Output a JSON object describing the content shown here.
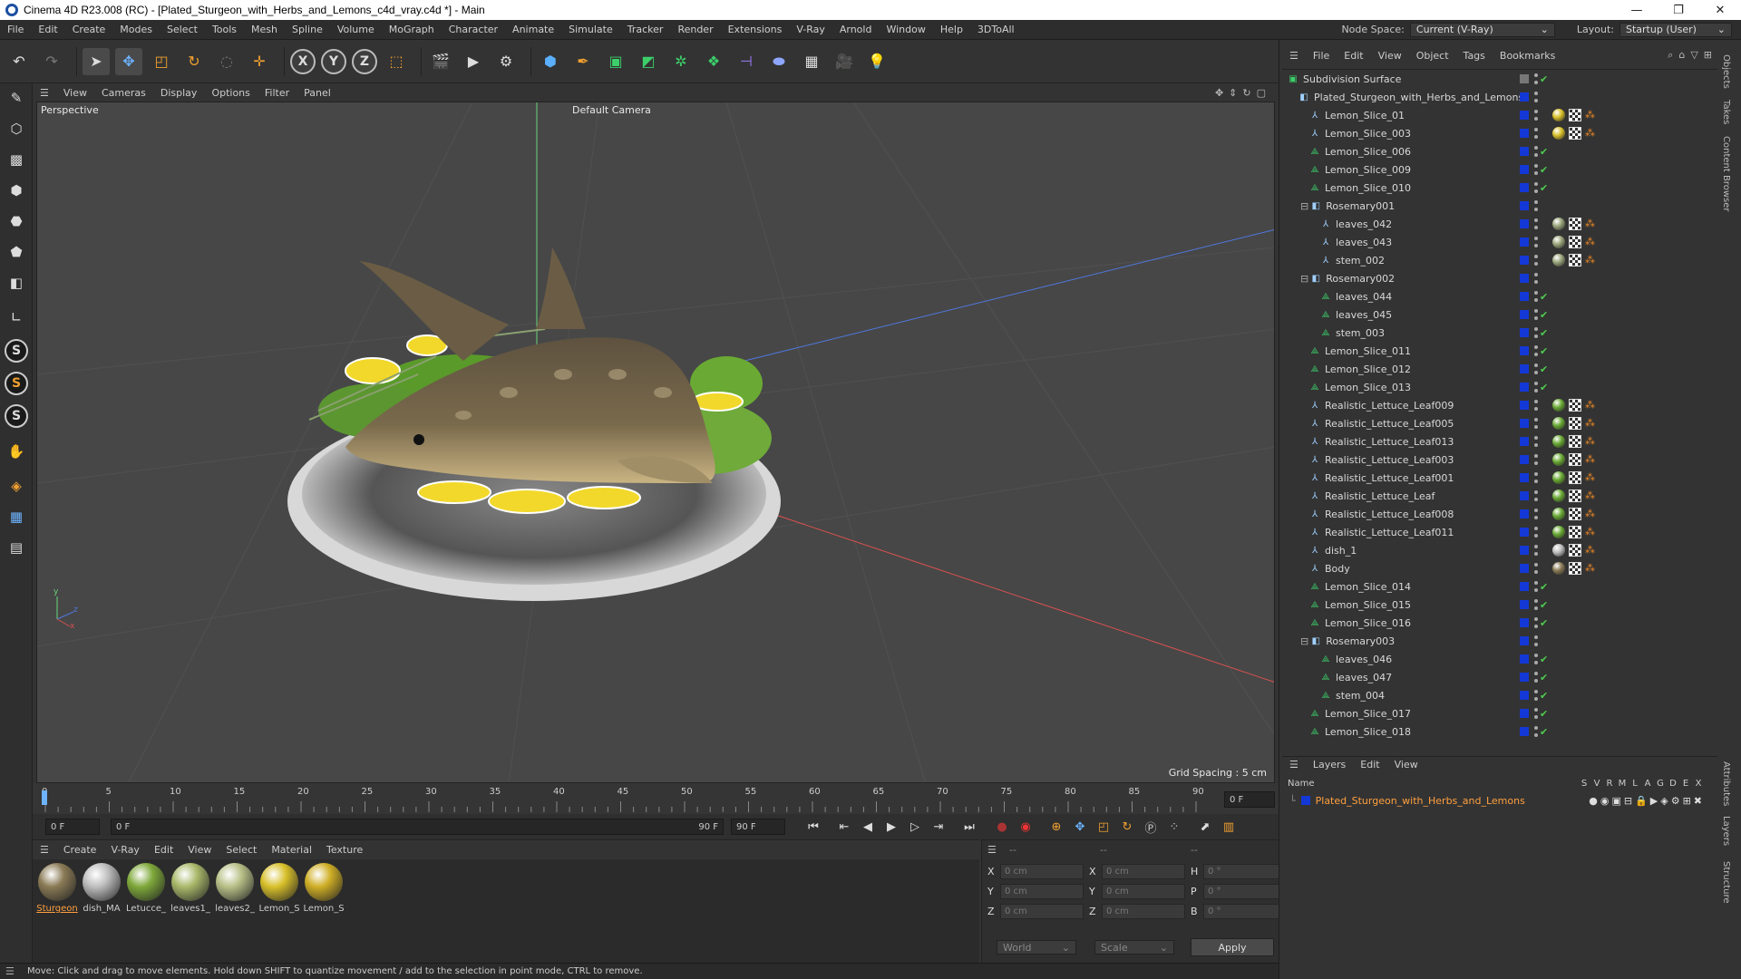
{
  "window": {
    "title": "Cinema 4D R23.008 (RC) - [Plated_Sturgeon_with_Herbs_and_Lemons_c4d_vray.c4d *] - Main",
    "buttons": [
      "—",
      "❐",
      "✕"
    ]
  },
  "menubar": {
    "items": [
      "File",
      "Edit",
      "Create",
      "Modes",
      "Select",
      "Tools",
      "Mesh",
      "Spline",
      "Volume",
      "MoGraph",
      "Character",
      "Animate",
      "Simulate",
      "Tracker",
      "Render",
      "Extensions",
      "V-Ray",
      "Arnold",
      "Window",
      "Help",
      "3DToAll"
    ],
    "node_space_label": "Node Space:",
    "node_space_value": "Current (V-Ray)",
    "layout_label": "Layout:",
    "layout_value": "Startup (User)"
  },
  "toolbar": {
    "axis_x": "X",
    "axis_y": "Y",
    "axis_z": "Z"
  },
  "viewport": {
    "menu": [
      "View",
      "Cameras",
      "Display",
      "Options",
      "Filter",
      "Panel"
    ],
    "name": "Perspective",
    "camera": "Default Camera",
    "grid_spacing": "Grid Spacing : 5 cm"
  },
  "timeline": {
    "ticks": [
      "0",
      "5",
      "10",
      "15",
      "20",
      "25",
      "30",
      "35",
      "40",
      "45",
      "50",
      "55",
      "60",
      "65",
      "70",
      "75",
      "80",
      "85",
      "90"
    ],
    "current_frame_field": "0 F",
    "start_field": "0 F",
    "range_start": "0 F",
    "range_end": "90 F",
    "end_field": "90 F"
  },
  "material_manager": {
    "menu": [
      "Create",
      "V-Ray",
      "Edit",
      "View",
      "Select",
      "Material",
      "Texture"
    ],
    "materials": [
      {
        "name": "Sturgeon",
        "color": "#8a7a55"
      },
      {
        "name": "dish_MA",
        "color": "#bdbdbd"
      },
      {
        "name": "Letucce_",
        "color": "#7ea83a"
      },
      {
        "name": "leaves1_",
        "color": "#a9b86a"
      },
      {
        "name": "leaves2_",
        "color": "#b8c087"
      },
      {
        "name": "Lemon_S",
        "color": "#d8c02a"
      },
      {
        "name": "Lemon_S",
        "color": "#cfae25"
      }
    ]
  },
  "coordinates": {
    "header": [
      "--",
      "--",
      "--"
    ],
    "rows": [
      {
        "a": "X",
        "v1": "0 cm",
        "b": "X",
        "v2": "0 cm",
        "c": "H",
        "v3": "0 °"
      },
      {
        "a": "Y",
        "v1": "0 cm",
        "b": "Y",
        "v2": "0 cm",
        "c": "P",
        "v3": "0 °"
      },
      {
        "a": "Z",
        "v1": "0 cm",
        "b": "Z",
        "v2": "0 cm",
        "c": "B",
        "v3": "0 °"
      }
    ],
    "space": "World",
    "mode": "Scale",
    "apply": "Apply"
  },
  "statusbar": {
    "text": "Move: Click and drag to move elements. Hold down SHIFT to quantize movement / add to the selection in point mode, CTRL to remove."
  },
  "object_manager": {
    "menu": [
      "File",
      "Edit",
      "View",
      "Object",
      "Tags",
      "Bookmarks"
    ],
    "objects": [
      {
        "name": "Subdivision Surface",
        "indent": 0,
        "icon": "subdivision",
        "tags": "none",
        "check": true
      },
      {
        "name": "Plated_Sturgeon_with_Herbs_and_Lemons",
        "indent": 1,
        "icon": "null",
        "tags": "none",
        "check": false
      },
      {
        "name": "Lemon_Slice_01",
        "indent": 2,
        "icon": "bone",
        "tags": "lemon",
        "check": false
      },
      {
        "name": "Lemon_Slice_003",
        "indent": 2,
        "icon": "bone",
        "tags": "lemon",
        "check": false
      },
      {
        "name": "Lemon_Slice_006",
        "indent": 2,
        "icon": "poly",
        "tags": "none",
        "check": true
      },
      {
        "name": "Lemon_Slice_009",
        "indent": 2,
        "icon": "poly",
        "tags": "none",
        "check": true
      },
      {
        "name": "Lemon_Slice_010",
        "indent": 2,
        "icon": "poly",
        "tags": "none",
        "check": true
      },
      {
        "name": "Rosemary001",
        "indent": 2,
        "icon": "null",
        "tags": "none",
        "check": false
      },
      {
        "name": "leaves_042",
        "indent": 3,
        "icon": "bone",
        "tags": "herb",
        "check": false
      },
      {
        "name": "leaves_043",
        "indent": 3,
        "icon": "bone",
        "tags": "herb",
        "check": false
      },
      {
        "name": "stem_002",
        "indent": 3,
        "icon": "bone",
        "tags": "herb",
        "check": false
      },
      {
        "name": "Rosemary002",
        "indent": 2,
        "icon": "null",
        "tags": "none",
        "check": false
      },
      {
        "name": "leaves_044",
        "indent": 3,
        "icon": "poly",
        "tags": "none",
        "check": true
      },
      {
        "name": "leaves_045",
        "indent": 3,
        "icon": "poly",
        "tags": "none",
        "check": true
      },
      {
        "name": "stem_003",
        "indent": 3,
        "icon": "poly",
        "tags": "none",
        "check": true
      },
      {
        "name": "Lemon_Slice_011",
        "indent": 2,
        "icon": "poly",
        "tags": "none",
        "check": true
      },
      {
        "name": "Lemon_Slice_012",
        "indent": 2,
        "icon": "poly",
        "tags": "none",
        "check": true
      },
      {
        "name": "Lemon_Slice_013",
        "indent": 2,
        "icon": "poly",
        "tags": "none",
        "check": true
      },
      {
        "name": "Realistic_Lettuce_Leaf009",
        "indent": 2,
        "icon": "bone",
        "tags": "lettuce",
        "check": false
      },
      {
        "name": "Realistic_Lettuce_Leaf005",
        "indent": 2,
        "icon": "bone",
        "tags": "lettuce",
        "check": false
      },
      {
        "name": "Realistic_Lettuce_Leaf013",
        "indent": 2,
        "icon": "bone",
        "tags": "lettuce",
        "check": false
      },
      {
        "name": "Realistic_Lettuce_Leaf003",
        "indent": 2,
        "icon": "bone",
        "tags": "lettuce",
        "check": false
      },
      {
        "name": "Realistic_Lettuce_Leaf001",
        "indent": 2,
        "icon": "bone",
        "tags": "lettuce",
        "check": false
      },
      {
        "name": "Realistic_Lettuce_Leaf",
        "indent": 2,
        "icon": "bone",
        "tags": "lettuce",
        "check": false
      },
      {
        "name": "Realistic_Lettuce_Leaf008",
        "indent": 2,
        "icon": "bone",
        "tags": "lettuce",
        "check": false
      },
      {
        "name": "Realistic_Lettuce_Leaf011",
        "indent": 2,
        "icon": "bone",
        "tags": "lettuce",
        "check": false
      },
      {
        "name": "dish_1",
        "indent": 2,
        "icon": "bone",
        "tags": "dish",
        "check": false
      },
      {
        "name": "Body",
        "indent": 2,
        "icon": "bone",
        "tags": "body",
        "check": false
      },
      {
        "name": "Lemon_Slice_014",
        "indent": 2,
        "icon": "poly",
        "tags": "none",
        "check": true
      },
      {
        "name": "Lemon_Slice_015",
        "indent": 2,
        "icon": "poly",
        "tags": "none",
        "check": true
      },
      {
        "name": "Lemon_Slice_016",
        "indent": 2,
        "icon": "poly",
        "tags": "none",
        "check": true
      },
      {
        "name": "Rosemary003",
        "indent": 2,
        "icon": "null",
        "tags": "none",
        "check": false
      },
      {
        "name": "leaves_046",
        "indent": 3,
        "icon": "poly",
        "tags": "none",
        "check": true
      },
      {
        "name": "leaves_047",
        "indent": 3,
        "icon": "poly",
        "tags": "none",
        "check": true
      },
      {
        "name": "stem_004",
        "indent": 3,
        "icon": "poly",
        "tags": "none",
        "check": true
      },
      {
        "name": "Lemon_Slice_017",
        "indent": 2,
        "icon": "poly",
        "tags": "none",
        "check": true
      },
      {
        "name": "Lemon_Slice_018",
        "indent": 2,
        "icon": "poly",
        "tags": "none",
        "check": true
      }
    ]
  },
  "layers": {
    "menu": [
      "Layers",
      "Edit",
      "View"
    ],
    "header_name": "Name",
    "header_flags": [
      "S",
      "V",
      "R",
      "M",
      "L",
      "A",
      "G",
      "D",
      "E",
      "X"
    ],
    "layer_name": "Plated_Sturgeon_with_Herbs_and_Lemons"
  },
  "side_tabs": [
    "Objects",
    "Takes",
    "Content Browser",
    "Attributes",
    "Layers",
    "Structure"
  ],
  "colors": {
    "accent_orange": "#ffa040",
    "layer_blue": "#1438d6",
    "check_green": "#4ecb4e"
  }
}
